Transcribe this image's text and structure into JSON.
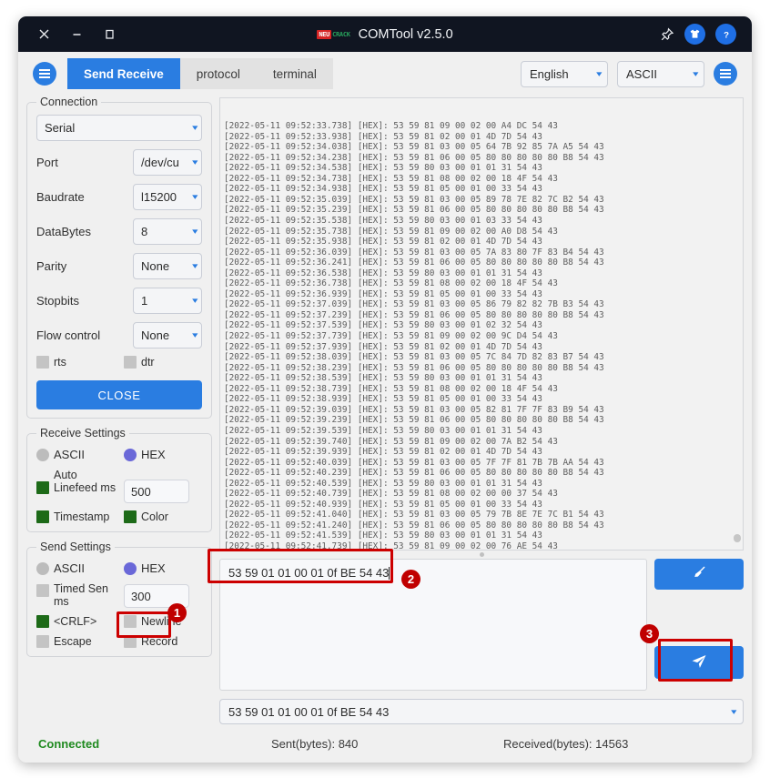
{
  "window": {
    "title": "COMTool v2.5.0",
    "logo_left": "NEU",
    "logo_right": "CRACK",
    "close_label": "✕",
    "minimize_label": "−",
    "maximize_label": "☐"
  },
  "toolbar": {
    "tabs": [
      {
        "label": "Send Receive",
        "active": true
      },
      {
        "label": "protocol",
        "active": false
      },
      {
        "label": "terminal",
        "active": false
      }
    ],
    "language": "English",
    "encoding": "ASCII"
  },
  "connection": {
    "title": "Connection",
    "type": "Serial",
    "fields": [
      {
        "label": "Port",
        "value": "/dev/cu"
      },
      {
        "label": "Baudrate",
        "value": "l15200"
      },
      {
        "label": "DataBytes",
        "value": "8"
      },
      {
        "label": "Parity",
        "value": "None"
      },
      {
        "label": "Stopbits",
        "value": "1"
      },
      {
        "label": "Flow control",
        "value": "None"
      }
    ],
    "rts_label": "rts",
    "dtr_label": "dtr",
    "close_button": "CLOSE"
  },
  "receive_settings": {
    "title": "Receive Settings",
    "ascii_label": "ASCII",
    "hex_label": "HEX",
    "mode": "HEX",
    "auto_linefeed_label": "Auto Linefeed ms",
    "auto_linefeed_value": "500",
    "timestamp_label": "Timestamp",
    "color_label": "Color"
  },
  "send_settings": {
    "title": "Send Settings",
    "ascii_label": "ASCII",
    "hex_label": "HEX",
    "mode": "HEX",
    "timed_send_label": "Timed Sen ms",
    "timed_send_value": "300",
    "crlf_label": "<CRLF>",
    "newline_label": "Newline",
    "escape_label": "Escape",
    "record_label": "Record"
  },
  "log": {
    "lines": [
      "[2022-05-11 09:52:33.738] [HEX]: 53 59 81 09 00 02 00 A4 DC 54 43",
      "[2022-05-11 09:52:33.938] [HEX]: 53 59 81 02 00 01 4D 7D 54 43",
      "[2022-05-11 09:52:34.038] [HEX]: 53 59 81 03 00 05 64 7B 92 85 7A A5 54 43",
      "[2022-05-11 09:52:34.238] [HEX]: 53 59 81 06 00 05 80 80 80 80 80 B8 54 43",
      "[2022-05-11 09:52:34.538] [HEX]: 53 59 80 03 00 01 01 31 54 43",
      "[2022-05-11 09:52:34.738] [HEX]: 53 59 81 08 00 02 00 18 4F 54 43",
      "[2022-05-11 09:52:34.938] [HEX]: 53 59 81 05 00 01 00 33 54 43",
      "[2022-05-11 09:52:35.039] [HEX]: 53 59 81 03 00 05 89 78 7E 82 7C B2 54 43",
      "[2022-05-11 09:52:35.239] [HEX]: 53 59 81 06 00 05 80 80 80 80 80 B8 54 43",
      "[2022-05-11 09:52:35.538] [HEX]: 53 59 80 03 00 01 03 33 54 43",
      "[2022-05-11 09:52:35.738] [HEX]: 53 59 81 09 00 02 00 A0 D8 54 43",
      "[2022-05-11 09:52:35.938] [HEX]: 53 59 81 02 00 01 4D 7D 54 43",
      "[2022-05-11 09:52:36.039] [HEX]: 53 59 81 03 00 05 7A 83 80 7F 83 B4 54 43",
      "[2022-05-11 09:52:36.241] [HEX]: 53 59 81 06 00 05 80 80 80 80 80 B8 54 43",
      "[2022-05-11 09:52:36.538] [HEX]: 53 59 80 03 00 01 01 31 54 43",
      "[2022-05-11 09:52:36.738] [HEX]: 53 59 81 08 00 02 00 18 4F 54 43",
      "[2022-05-11 09:52:36.939] [HEX]: 53 59 81 05 00 01 00 33 54 43",
      "[2022-05-11 09:52:37.039] [HEX]: 53 59 81 03 00 05 86 79 82 82 7B B3 54 43",
      "[2022-05-11 09:52:37.239] [HEX]: 53 59 81 06 00 05 80 80 80 80 80 B8 54 43",
      "[2022-05-11 09:52:37.539] [HEX]: 53 59 80 03 00 01 02 32 54 43",
      "[2022-05-11 09:52:37.739] [HEX]: 53 59 81 09 00 02 00 9C D4 54 43",
      "[2022-05-11 09:52:37.939] [HEX]: 53 59 81 02 00 01 4D 7D 54 43",
      "[2022-05-11 09:52:38.039] [HEX]: 53 59 81 03 00 05 7C 84 7D 82 83 B7 54 43",
      "[2022-05-11 09:52:38.239] [HEX]: 53 59 81 06 00 05 80 80 80 80 80 B8 54 43",
      "[2022-05-11 09:52:38.539] [HEX]: 53 59 80 03 00 01 01 31 54 43",
      "[2022-05-11 09:52:38.739] [HEX]: 53 59 81 08 00 02 00 18 4F 54 43",
      "[2022-05-11 09:52:38.939] [HEX]: 53 59 81 05 00 01 00 33 54 43",
      "[2022-05-11 09:52:39.039] [HEX]: 53 59 81 03 00 05 82 81 7F 7F 83 B9 54 43",
      "[2022-05-11 09:52:39.239] [HEX]: 53 59 81 06 00 05 80 80 80 80 80 B8 54 43",
      "[2022-05-11 09:52:39.539] [HEX]: 53 59 80 03 00 01 01 31 54 43",
      "[2022-05-11 09:52:39.740] [HEX]: 53 59 81 09 00 02 00 7A B2 54 43",
      "[2022-05-11 09:52:39.939] [HEX]: 53 59 81 02 00 01 4D 7D 54 43",
      "[2022-05-11 09:52:40.039] [HEX]: 53 59 81 03 00 05 7F 7F 81 7B 7B AA 54 43",
      "[2022-05-11 09:52:40.239] [HEX]: 53 59 81 06 00 05 80 80 80 80 80 B8 54 43",
      "[2022-05-11 09:52:40.539] [HEX]: 53 59 80 03 00 01 01 31 54 43",
      "[2022-05-11 09:52:40.739] [HEX]: 53 59 81 08 00 02 00 00 37 54 43",
      "[2022-05-11 09:52:40.939] [HEX]: 53 59 81 05 00 01 00 33 54 43",
      "[2022-05-11 09:52:41.040] [HEX]: 53 59 81 03 00 05 79 7B 8E 7E 7C B1 54 43",
      "[2022-05-11 09:52:41.240] [HEX]: 53 59 81 06 00 05 80 80 80 80 80 B8 54 43",
      "[2022-05-11 09:52:41.539] [HEX]: 53 59 80 03 00 01 01 31 54 43",
      "[2022-05-11 09:52:41.739] [HEX]: 53 59 81 09 00 02 00 76 AE 54 43"
    ]
  },
  "send": {
    "input_value": "53 59 01 01 00 01 0f BE 54 43",
    "history_value": "53 59 01 01 00 01 0f BE 54 43",
    "clear_icon": "broom-icon",
    "send_icon": "paper-plane-icon"
  },
  "status": {
    "connected": "Connected",
    "sent": "Sent(bytes): 840",
    "received": "Received(bytes): 14563"
  },
  "annotations": {
    "markers": [
      {
        "id": "1",
        "target": "send-settings-hex"
      },
      {
        "id": "2",
        "target": "send-input"
      },
      {
        "id": "3",
        "target": "send-button"
      }
    ]
  },
  "colors": {
    "accent": "#2a7de1",
    "title_bg": "#101521",
    "checked_green": "#1d6a18",
    "radio_purple": "#6a68d8",
    "highlight_red": "#cc0000",
    "connected_green": "#1f8a1f"
  }
}
